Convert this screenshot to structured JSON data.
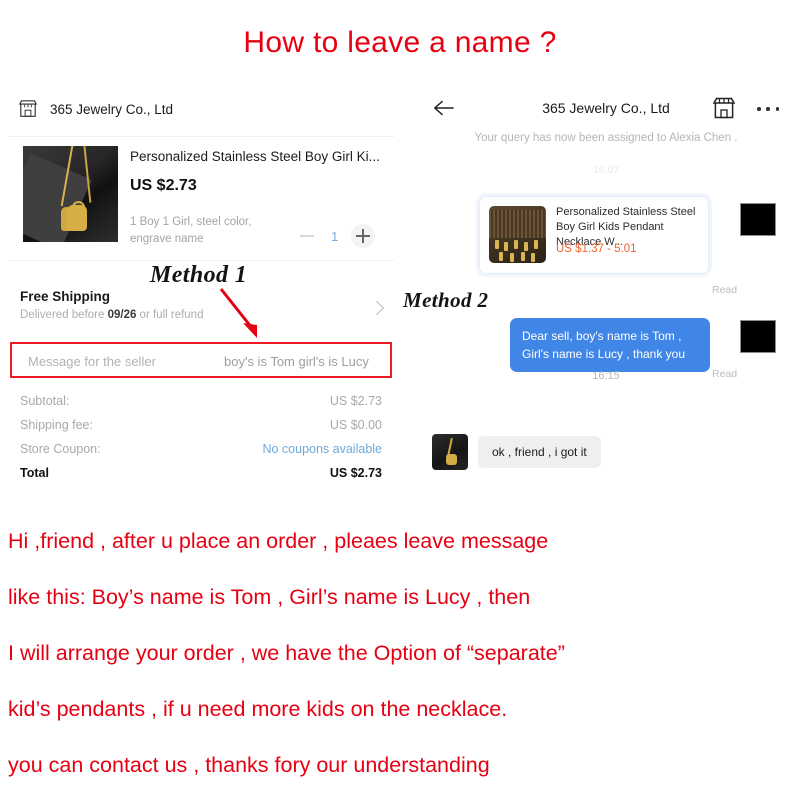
{
  "title": "How to leave a name ?",
  "colors": {
    "red_accent": "#e60012",
    "box_red": "#ee1b24",
    "chat_blue": "#4086e6",
    "price_orange": "#f0642c",
    "link_blue": "#6fa8dc"
  },
  "left_panel": {
    "store_icon": "shop-icon",
    "store_name": "365 Jewelry Co., Ltd",
    "product": {
      "title": "Personalized Stainless Steel Boy Girl Ki...",
      "price": "US $2.73",
      "options": "1 Boy 1 Girl, steel color, engrave name",
      "quantity": "1",
      "minus_label": "−",
      "plus_label": "+"
    },
    "shipping": {
      "title": "Free Shipping",
      "detail_prefix": "Delivered before ",
      "detail_date": "09/26",
      "detail_suffix": " or full refund"
    },
    "message_field": {
      "placeholder": "Message for the seller",
      "value": "boy's is Tom   girl's is Lucy"
    },
    "totals": [
      {
        "label": "Subtotal:",
        "value": "US $2.73",
        "style": "normal"
      },
      {
        "label": "Shipping fee:",
        "value": "US $0.00",
        "style": "normal"
      },
      {
        "label": "Store Coupon:",
        "value": "No coupons available",
        "style": "link"
      },
      {
        "label": "Total",
        "value": "US $2.73",
        "style": "total"
      }
    ]
  },
  "annotations": {
    "method1": "Method 1",
    "method2": "Method 2"
  },
  "right_panel": {
    "back_icon": "back-arrow-icon",
    "title": "365 Jewelry Co., Ltd",
    "shop_icon": "shop-icon",
    "more_icon": "more-options-icon",
    "assignment_note": "Your query has now been assigned to Alexia Chen .",
    "timestamp_top": "16:07",
    "product_card": {
      "title": "Personalized Stainless Steel Boy Girl Kids Pendant Necklace W...",
      "price": "US $1.37 - 5.01"
    },
    "read_label_1": "Read",
    "outgoing_message": "Dear sell, boy's name is Tom , Girl's name is Lucy , thank you",
    "read_label_2": "Read",
    "timestamp_mid": "16:15",
    "incoming_message": "ok , friend , i got it"
  },
  "footer_lines": [
    "Hi ,friend , after u place an order , pleaes leave message",
    "like this: Boy’s name is Tom , Girl’s name is Lucy , then",
    "I will arrange your order , we have the Option of “separate”",
    "kid’s pendants , if u need more kids on the necklace.",
    "you can contact us , thanks fory our understanding"
  ]
}
